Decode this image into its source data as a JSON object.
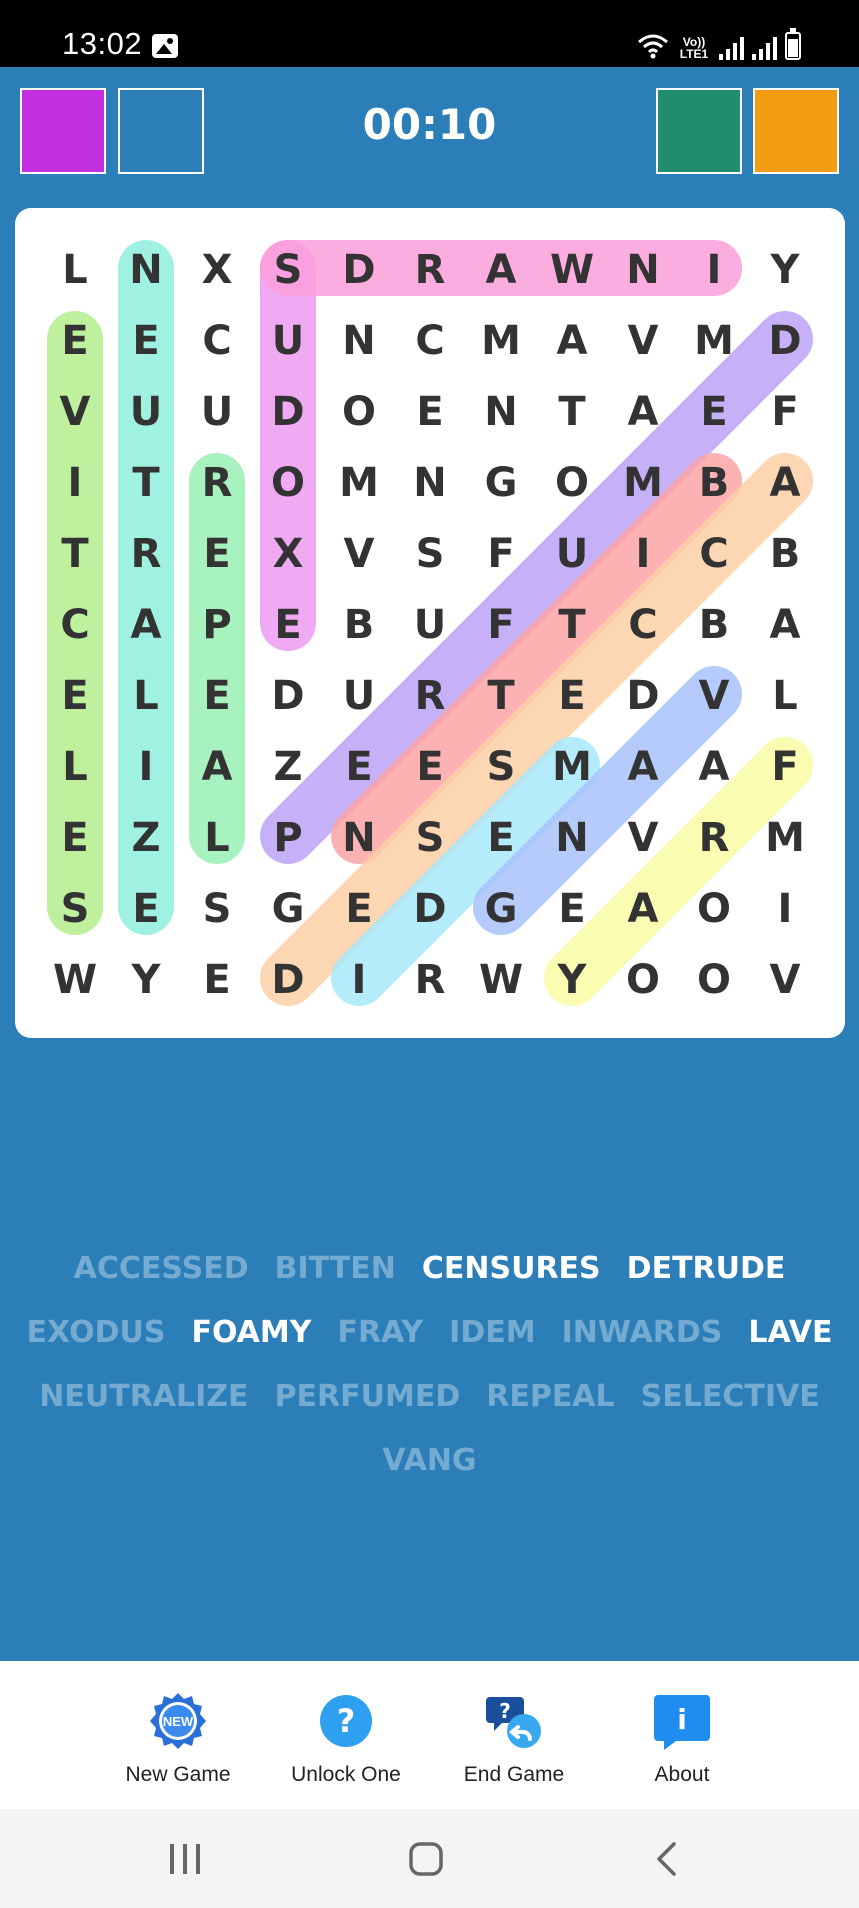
{
  "status_bar": {
    "time": "13:02",
    "network_label": "Vo)) LTE1",
    "icons": [
      "gallery-icon",
      "wifi-icon",
      "signal-icon",
      "signal-icon",
      "battery-icon"
    ]
  },
  "header": {
    "timer": "00:10",
    "swatches": [
      "#c12fe0",
      "#2b7eb8",
      "#1e8e6e",
      "#f39c12"
    ]
  },
  "grid": {
    "rows": [
      [
        "L",
        "N",
        "X",
        "S",
        "D",
        "R",
        "A",
        "W",
        "N",
        "I",
        "Y"
      ],
      [
        "E",
        "E",
        "C",
        "U",
        "N",
        "C",
        "M",
        "A",
        "V",
        "M",
        "D"
      ],
      [
        "V",
        "U",
        "U",
        "D",
        "O",
        "E",
        "N",
        "T",
        "A",
        "E",
        "F"
      ],
      [
        "I",
        "T",
        "R",
        "O",
        "M",
        "N",
        "G",
        "O",
        "M",
        "B",
        "A"
      ],
      [
        "T",
        "R",
        "E",
        "X",
        "V",
        "S",
        "F",
        "U",
        "I",
        "C",
        "B"
      ],
      [
        "C",
        "A",
        "P",
        "E",
        "B",
        "U",
        "F",
        "T",
        "C",
        "B",
        "A"
      ],
      [
        "E",
        "L",
        "E",
        "D",
        "U",
        "R",
        "T",
        "E",
        "D",
        "V",
        "L"
      ],
      [
        "L",
        "I",
        "A",
        "Z",
        "E",
        "E",
        "S",
        "M",
        "A",
        "A",
        "F"
      ],
      [
        "E",
        "Z",
        "L",
        "P",
        "N",
        "S",
        "E",
        "N",
        "V",
        "R",
        "M"
      ],
      [
        "S",
        "E",
        "S",
        "G",
        "E",
        "D",
        "G",
        "E",
        "A",
        "O",
        "I"
      ],
      [
        "W",
        "Y",
        "E",
        "D",
        "I",
        "R",
        "W",
        "Y",
        "O",
        "O",
        "V"
      ]
    ],
    "highlights": [
      {
        "word": "SELECTIVE",
        "from": [
          9,
          0
        ],
        "to": [
          1,
          0
        ],
        "color": "#b5ee8c"
      },
      {
        "word": "NEUTRALIZE",
        "from": [
          0,
          1
        ],
        "to": [
          9,
          1
        ],
        "color": "#8ff0dc"
      },
      {
        "word": "REPEAL",
        "from": [
          3,
          2
        ],
        "to": [
          8,
          2
        ],
        "color": "#9af0b4"
      },
      {
        "word": "EXODUS",
        "from": [
          5,
          3
        ],
        "to": [
          0,
          3
        ],
        "color": "#ee9cf2"
      },
      {
        "word": "INWARDS",
        "from": [
          0,
          9
        ],
        "to": [
          0,
          3
        ],
        "color": "#fc9fdb"
      },
      {
        "word": "PERFUMED",
        "from": [
          8,
          3
        ],
        "to": [
          1,
          10
        ],
        "color": "#bda4f8"
      },
      {
        "word": "CENSURES",
        "from": [
          8,
          4
        ],
        "to": [
          3,
          9
        ],
        "color": "#fca5a5"
      },
      {
        "word": "DETRUDE",
        "from": [
          10,
          3
        ],
        "to": [
          3,
          10
        ],
        "color": "#fdd0a6"
      },
      {
        "word": "IDEM",
        "from": [
          10,
          4
        ],
        "to": [
          7,
          7
        ],
        "color": "#a9e9fb"
      },
      {
        "word": "VANG",
        "from": [
          6,
          9
        ],
        "to": [
          9,
          6
        ],
        "color": "#a9c3fb"
      },
      {
        "word": "FOAMY",
        "from": [
          7,
          10
        ],
        "to": [
          10,
          7
        ],
        "color": "#fafca4"
      }
    ]
  },
  "word_list": [
    [
      {
        "text": "ACCESSED",
        "active": false
      },
      {
        "text": "BITTEN",
        "active": false
      },
      {
        "text": "CENSURES",
        "active": true
      },
      {
        "text": "DETRUDE",
        "active": true
      }
    ],
    [
      {
        "text": "EXODUS",
        "active": false
      },
      {
        "text": "FOAMY",
        "active": true
      },
      {
        "text": "FRAY",
        "active": false
      },
      {
        "text": "IDEM",
        "active": false
      },
      {
        "text": "INWARDS",
        "active": false
      },
      {
        "text": "LAVE",
        "active": true
      }
    ],
    [
      {
        "text": "NEUTRALIZE",
        "active": false
      },
      {
        "text": "PERFUMED",
        "active": false
      },
      {
        "text": "REPEAL",
        "active": false
      },
      {
        "text": "SELECTIVE",
        "active": false
      }
    ],
    [
      {
        "text": "VANG",
        "active": false
      }
    ]
  ],
  "bottom_nav": {
    "new_game": {
      "label": "New Game",
      "badge": "NEW",
      "icon": "new-badge-icon"
    },
    "unlock_one": {
      "label": "Unlock One",
      "glyph": "?",
      "icon": "question-icon"
    },
    "end_game": {
      "label": "End Game",
      "glyph": "?",
      "icon": "end-game-icon"
    },
    "about": {
      "label": "About",
      "glyph": "i",
      "icon": "info-icon"
    }
  },
  "system_nav": [
    "recents-icon",
    "home-icon",
    "back-icon"
  ]
}
